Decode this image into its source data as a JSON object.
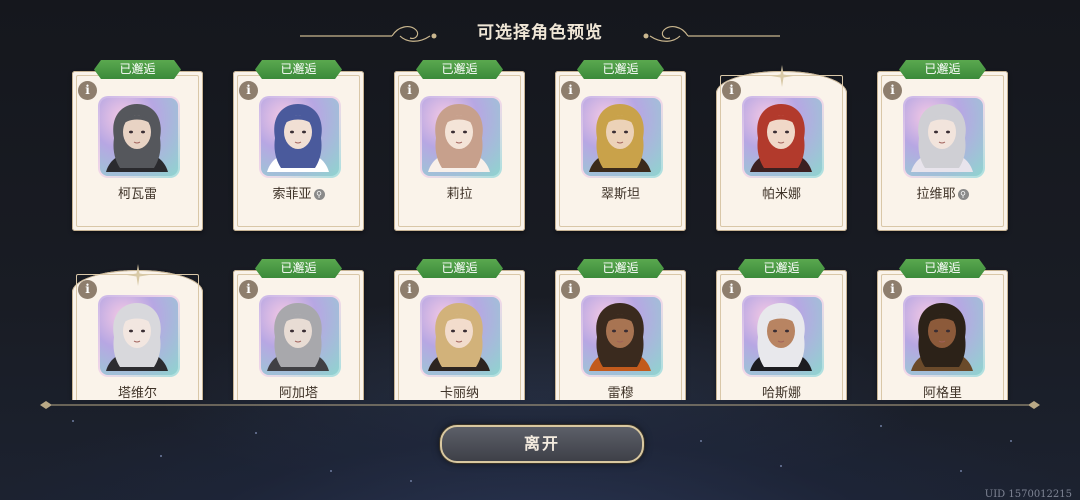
{
  "header": {
    "title": "可选择角色预览"
  },
  "badge_label": "已邂逅",
  "info_glyph": "i",
  "lock_glyph": "⚲",
  "cards_row1": [
    {
      "name": "柯瓦雷",
      "met": true,
      "locked": false,
      "hair": "#55575c",
      "skin": "#e8d3c4",
      "shirt": "#2a2a2e"
    },
    {
      "name": "索菲亚",
      "met": true,
      "locked": true,
      "hair": "#4a5a9c",
      "skin": "#f1dfd4",
      "shirt": "#ffffff"
    },
    {
      "name": "莉拉",
      "met": true,
      "locked": false,
      "hair": "#c7a08c",
      "skin": "#f4e4d8",
      "shirt": "#f8f0ea"
    },
    {
      "name": "翠斯坦",
      "met": true,
      "locked": false,
      "hair": "#c9a24a",
      "skin": "#ecd2b8",
      "shirt": "#3b2a1a"
    },
    {
      "name": "帕米娜",
      "met": false,
      "locked": false,
      "hair": "#b23a2c",
      "skin": "#f0d8c8",
      "shirt": "#3c2020"
    },
    {
      "name": "拉维耶",
      "met": true,
      "locked": true,
      "hair": "#cfcfd4",
      "skin": "#f2e4dc",
      "shirt": "#e8e4ec"
    }
  ],
  "cards_row2": [
    {
      "name": "塔维尔",
      "met": false,
      "hair": "#d8d8dc",
      "skin": "#f2e6e0",
      "shirt": "#2c2c30"
    },
    {
      "name": "阿加塔",
      "met": true,
      "hair": "#a8a8ac",
      "skin": "#e8dcd4",
      "shirt": "#404044"
    },
    {
      "name": "卡丽纳",
      "met": true,
      "hair": "#d2b27a",
      "skin": "#f2dccc",
      "shirt": "#2c2420"
    },
    {
      "name": "雷穆",
      "met": true,
      "hair": "#3a2a1e",
      "skin": "#a87452",
      "shirt": "#c25a1c"
    },
    {
      "name": "哈斯娜",
      "met": true,
      "hair": "#e8e8ec",
      "skin": "#b88462",
      "shirt": "#1c1c20"
    },
    {
      "name": "阿格里",
      "met": true,
      "hair": "#2c2218",
      "skin": "#8c5a3a",
      "shirt": "#6a4a2a"
    }
  ],
  "leave_button": {
    "label": "离开"
  },
  "uid_text": "UID 1570012215"
}
